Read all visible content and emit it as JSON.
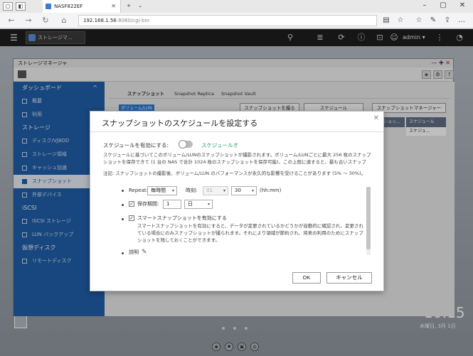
{
  "browser": {
    "tab_title": "NASF822EF",
    "url_host": "192.168.1.56",
    "url_path": ":8080/cgi-bin"
  },
  "qts": {
    "app_tab_label": "ストレージマ...",
    "user": "admin ▾"
  },
  "storage_manager": {
    "title": "ストレージマネージャ",
    "sidebar": {
      "dashboard": "ダッシュボード",
      "overview": "概要",
      "utilization": "利用",
      "storage": "ストレージ",
      "disks": "ディスク/VJBOD",
      "storage_space": "ストレージ領域",
      "cache": "キャッシュ加速",
      "snapshot": "スナップショット",
      "external": "外部デバイス",
      "iscsi": "iSCSI",
      "iscsi_storage": "iSCSI ストレージ",
      "lun_backup": "LUN バックアップ",
      "virtual_disk": "仮想ディスク",
      "remote_disk": "リモートディスク"
    },
    "tabs": [
      "スナップショット",
      "Snapshot Replica",
      "Snapshot Vault"
    ],
    "volume_btn": "ボリューム/LUN",
    "actions": {
      "take_snapshot": "スナップショットを撮る",
      "schedule": "スケジュール",
      "snapshot_manager": "スナップショットマネージャー"
    },
    "grid": {
      "col1": "ショッ...",
      "col2": "スケジュール",
      "row_value": "スケジュ..."
    }
  },
  "desktop": {
    "clock": "10:15",
    "date": "水曜日, 3月 1日"
  },
  "dialog": {
    "title": "スナップショットのスケジュールを設定する",
    "enable_label": "スケジュールを有効にする:",
    "enable_link": "スケジュールオ",
    "description": "スケジュールに基づいてこのボリューム/LUNのスナップショットが撮影されます。ボリューム/LUNごとに最大 256 枚のスナップショットを保存できて (1 台の NAS で合計 1024 枚のスナップショットを保存可能)、この上限に達すると、最も古いスナップ",
    "note": "注記: スナップショットの撮影後、ボリューム/LUN のパフォーマンスが永久的な影響を受けることがあります (5% 〜 30%)。",
    "repeat_label": "Repeat:",
    "repeat_value": "毎時間",
    "time_label": "時刻:",
    "hour_value": "01",
    "minute_value": "30",
    "time_unit": "(hh:mm)",
    "retention_label": "保存期間:",
    "retention_value": "1",
    "retention_unit": "日",
    "smart_label": "スマートスナップショットを有効にする",
    "smart_desc": "スマートスナップショットを有効にすると、データが変更されているかどうかが自動的に確認され、変更されている場合にのみスナップショットが撮られます。それにより領域が節約され、将来の利用のためにスナップショットを残しておくことができます。",
    "desc_label": "説明",
    "ok": "OK",
    "cancel": "キャンセル"
  }
}
